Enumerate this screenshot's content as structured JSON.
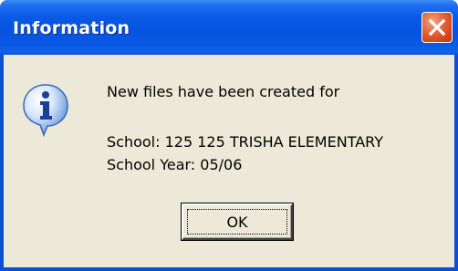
{
  "window": {
    "title": "Information"
  },
  "icon": "information-icon",
  "message": {
    "line1": "New files have been created for",
    "school": "School: 125 125 TRISHA ELEMENTARY",
    "school_year": "School Year: 05/06"
  },
  "buttons": {
    "ok_label": "OK"
  },
  "colors": {
    "titlebar": "#0553df",
    "dialog_body": "#ece9d8",
    "close_button": "#d24417"
  }
}
